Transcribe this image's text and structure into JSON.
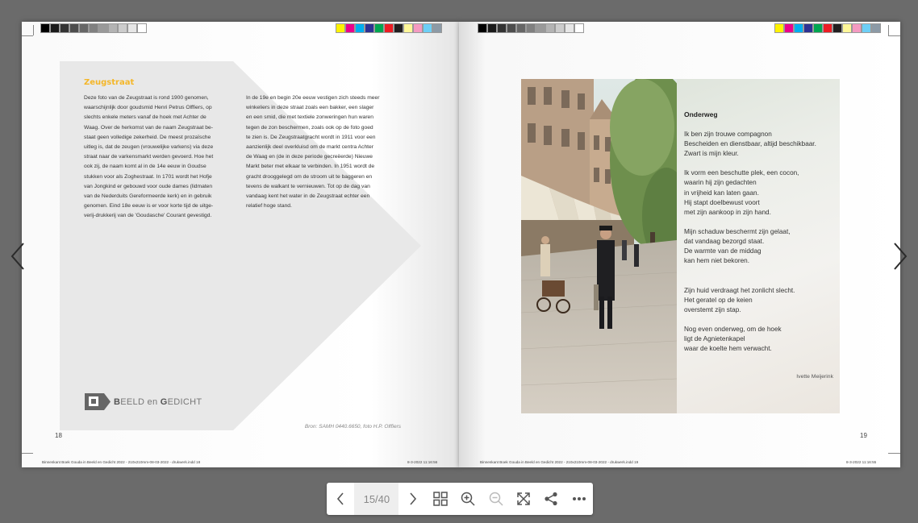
{
  "left_page": {
    "heading": "Zeugstraat",
    "col1": [
      "Deze foto van de Zeugstraat is rond 1900 genomen,",
      "waarschijnlijk door goudsmid Henri Petrus Olffiers, op",
      "slechts enkele meters vanaf de hoek met Achter de",
      "Waag. Over de herkomst van de naam Zeugstraat be-",
      "staat geen volledige zekerheid. De meest prozaïsche",
      "uitleg is, dat de zeugen (vrouwelijke varkens) via deze",
      "straat naar de varkensmarkt werden gevoerd. Hoe het",
      "ook zij, de naam komt al in de 14e eeuw in Goudse",
      "stukken voor als Zoghestraat. In 1701 wordt het Hofje",
      "van Jongkind er gebouwd voor oude dames (lidmaten",
      "van de Nederduits Gereformeerde kerk) en in gebruik",
      "genomen. Eind 18e eeuw is er voor korte tijd de uitge-",
      "verij-drukkerij van de 'Goudasche' Courant gevestigd."
    ],
    "col2": [
      "In de 19e en begin 20e eeuw vestigen zich steeds meer",
      "winkeliers in deze straat zoals een bakker, een slager",
      "en een smid, die met textiele zonweringen hun waren",
      "tegen de zon beschermen, zoals ook op de foto goed",
      "te zien is. De Zeugstraatgracht wordt in 1911 voor een",
      "aanzienlijk deel overkluisd om de markt centra Achter",
      "de Waag en (de in deze periode gecreëerde) Nieuwe",
      "Markt beter met elkaar te verbinden. In 1951 wordt de",
      "gracht drooggelegd om de stroom uit te baggeren en",
      "tevens de walkant te vernieuwen. Tot op de dag van",
      "vandaag kent het water in de Zeugstraat echter een",
      "relatief hoge stand."
    ],
    "logo_b1": "B",
    "logo_rest1": "EELD",
    "logo_en": "en",
    "logo_g": "G",
    "logo_rest2": "EDICHT",
    "caption": "Bron: SAMH 0440.6650, foto H.P. Olffiers",
    "page_number": "18",
    "footer_left": "Binnenkant Boek Gouda in Beeld en Gedicht 2022 - 210x210mm-08-03-2022 - drukwerk.indd   18",
    "footer_right": "8-3-2022   11:16:56"
  },
  "right_page": {
    "poem_title": "Onderweg",
    "poem": "Ik ben zijn trouwe compagnon\nBescheiden en dienstbaar, altijd beschikbaar.\nZwart is mijn kleur.\n\nIk vorm een beschutte plek, een cocon,\nwaarin hij zijn gedachten\nin vrijheid kan laten gaan.\nHij stapt doelbewust voort\nmet zijn aankoop in zijn hand.\n\nMijn schaduw beschermt zijn gelaat,\ndat vandaag bezorgd staat.\nDe warmte van de middag\nkan hem niet bekoren.\n\n\nZijn huid verdraagt het zonlicht slecht.\nHet geratel op de keien\noverstemt zijn stap.\n\nNog even onderweg, om de hoek\nligt de Agnietenkapel\nwaar de koelte hem verwacht.",
    "author": "Ivette Meijerink",
    "page_number": "19",
    "footer_left": "Binnenkant Boek Gouda in Beeld en Gedicht 2022 - 210x210mm-08-03-2022 - drukwerk.indd   19",
    "footer_right": "8-3-2022   11:16:55"
  },
  "toolbar": {
    "page_counter": "15/40"
  },
  "colors": {
    "accent_heading": "#f4b628",
    "background": "#6b6b6b",
    "grey_bars": [
      "#000000",
      "#1a1a1a",
      "#333333",
      "#4d4d4d",
      "#666666",
      "#808080",
      "#999999",
      "#b3b3b3",
      "#cccccc",
      "#e6e6e6",
      "#ffffff"
    ],
    "color_bars": [
      "#fff200",
      "#ec008c",
      "#00aeef",
      "#2e3192",
      "#00a651",
      "#ed1c24",
      "#231f20",
      "#fff799",
      "#f49ac1",
      "#6dcff6",
      "#8c9aa6"
    ]
  },
  "icons": [
    "prev-page-icon",
    "next-page-icon",
    "chevron-left-icon",
    "chevron-right-icon",
    "thumbnails-icon",
    "zoom-in-icon",
    "zoom-out-icon",
    "fullscreen-icon",
    "share-icon",
    "more-icon"
  ]
}
